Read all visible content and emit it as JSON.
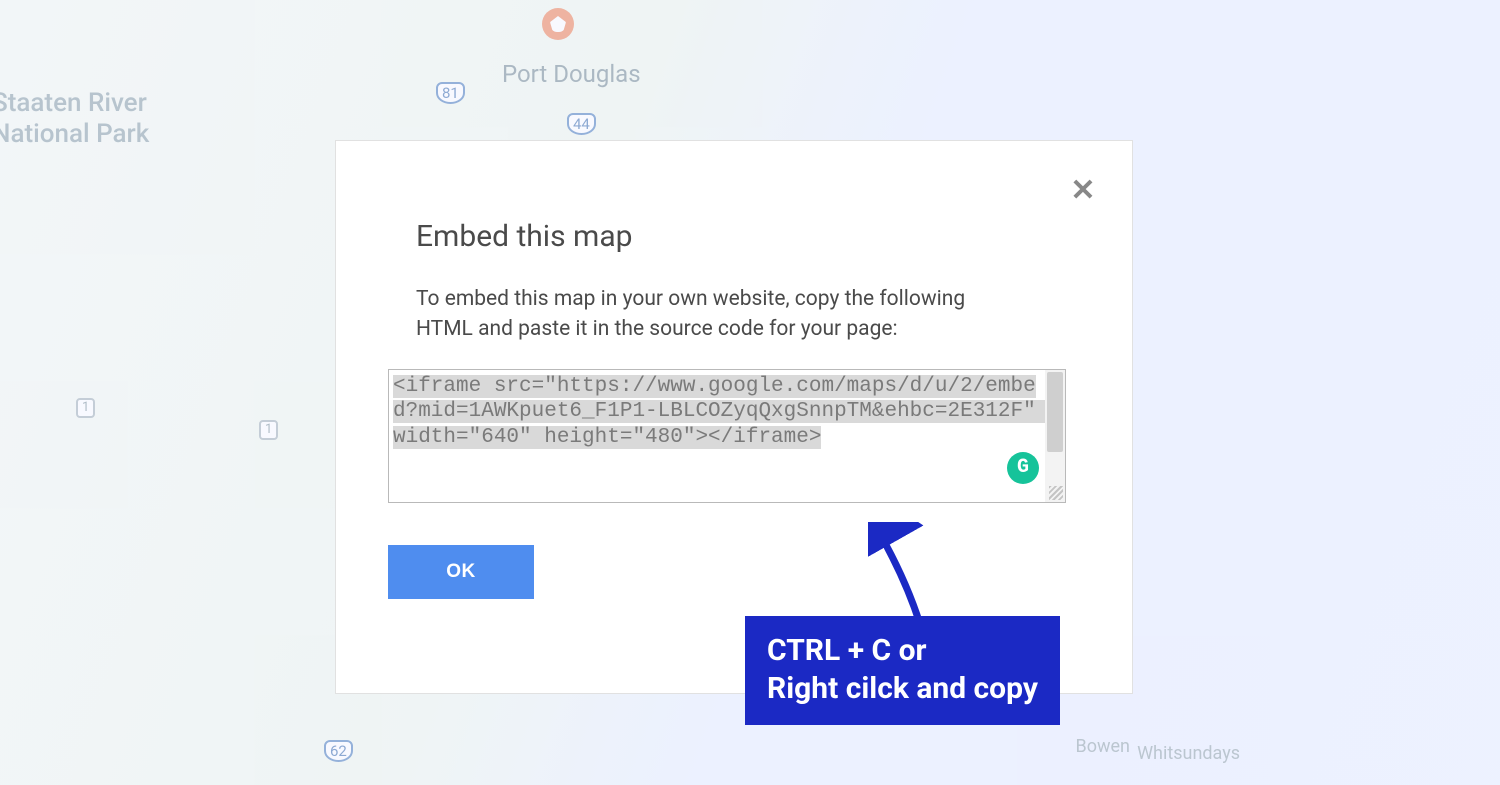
{
  "map": {
    "park_label": "Staaten River\nNational Park",
    "port_label": "Port Douglas",
    "shield_81": "81",
    "shield_44": "44",
    "shield_62": "62",
    "shield_sq": "1",
    "bowen": "Bowen",
    "whitsundays": "Whitsundays"
  },
  "dialog": {
    "title": "Embed this map",
    "description": "To embed this map in your own website, copy the following HTML and paste it in the source code for your page:",
    "embed_code": "<iframe src=\"https://www.google.com/maps/d/u/2/embed?mid=1AWKpuet6_F1P1-LBLCOZyqQxgSnnpTM&ehbc=2E312F\" width=\"640\" height=\"480\"></iframe>",
    "ok_label": "OK",
    "close_glyph": "✕",
    "grammarly_glyph": "G"
  },
  "annotation": {
    "text": "CTRL + C or\nRight cilck and copy"
  }
}
